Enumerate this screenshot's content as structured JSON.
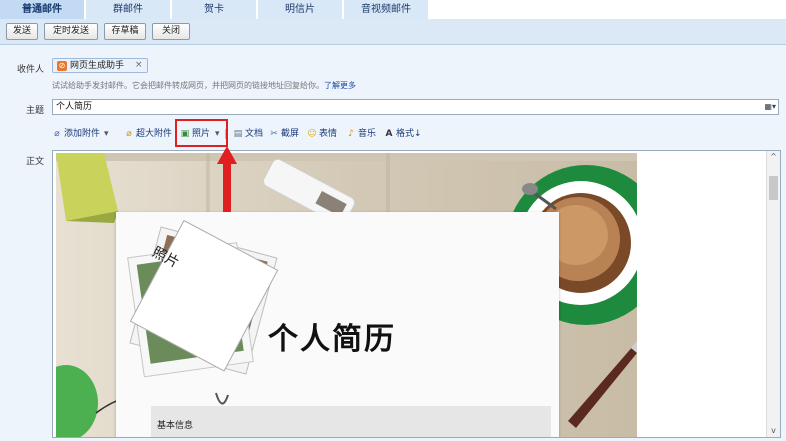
{
  "tabs": [
    "普通邮件",
    "群邮件",
    "贺卡",
    "明信片",
    "音视频邮件"
  ],
  "toolbar": {
    "send": "发送",
    "schedule": "定时发送",
    "save_draft": "存草稿",
    "close": "关闭"
  },
  "form": {
    "recipient_label": "收件人",
    "recipient_chip": "网页生成助手",
    "recipient_remove": "×",
    "hint_text": "试试给助手发封邮件。它会把邮件转成网页，并把网页的链接地址回复给你。",
    "hint_link": "了解更多",
    "subject_label": "主题",
    "subject_value": "个人简历",
    "body_label": "正文"
  },
  "attachments": {
    "add": "添加附件",
    "large": "超大附件",
    "photo": "照片",
    "doc": "文档",
    "screenshot": "截屏",
    "emoji": "表情",
    "music": "音乐",
    "format": "格式↓"
  },
  "body_content": {
    "photo_label": "照片",
    "title": "个人简历",
    "section": "基本信息"
  },
  "colors": {
    "tab_active": "#c2daf3",
    "tab": "#d9e8f7",
    "toolbar": "#dbe8f6",
    "highlight": "#e02020"
  }
}
